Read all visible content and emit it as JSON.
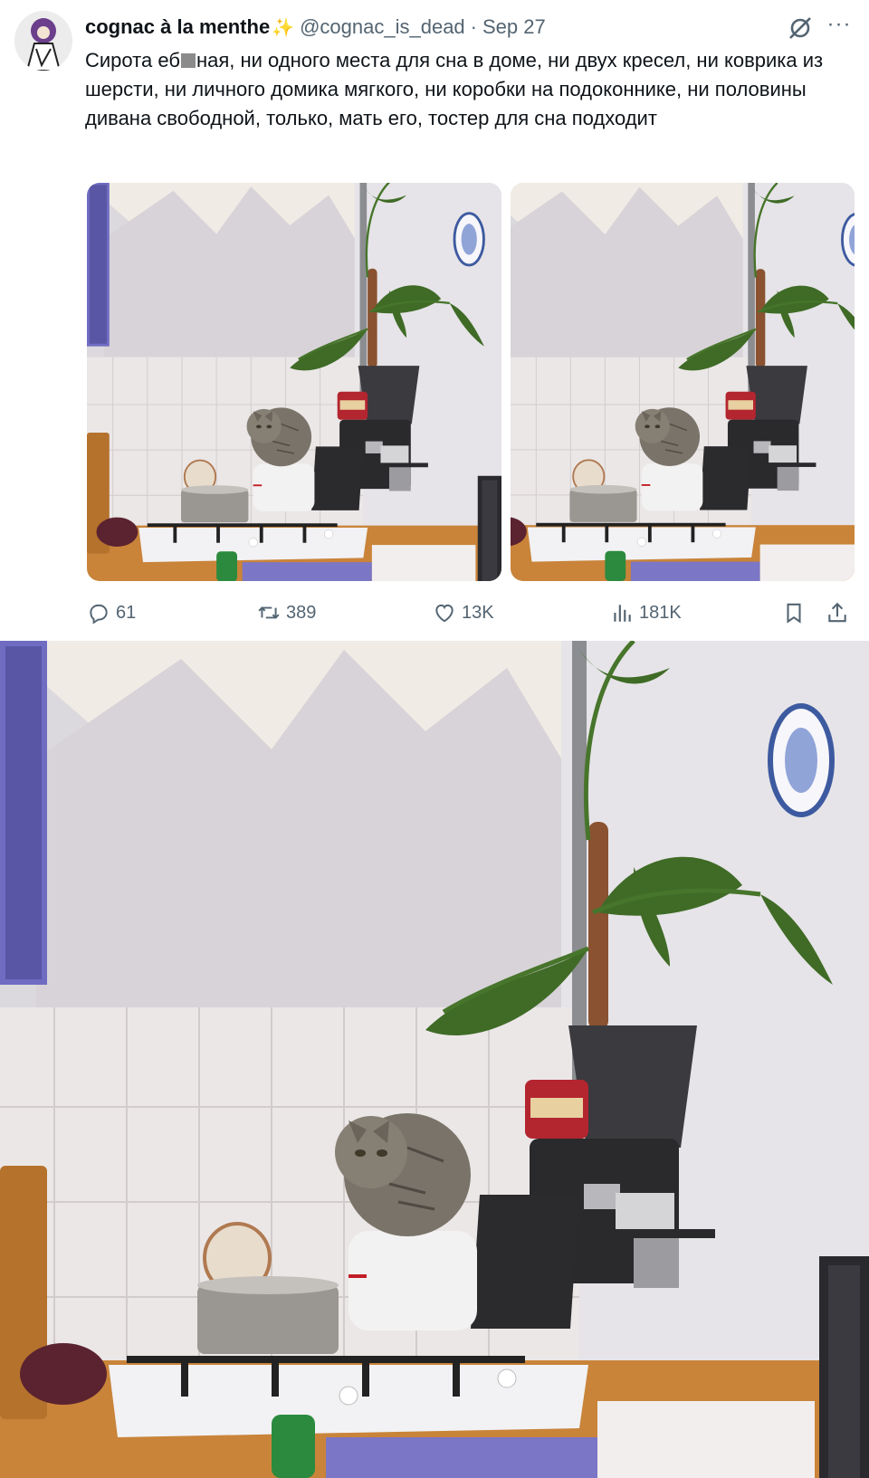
{
  "tweet": {
    "display_name": "cognac à la menthe",
    "sparkle": "✨",
    "handle": "@cognac_is_dead",
    "separator": "·",
    "date": "Sep 27",
    "text_before_redaction": "Сирота еб",
    "text_after_redaction": "ная, ни одного места для сна в доме, ни двух кресел, ни коврика из шерсти, ни личного домика мягкого, ни коробки на подоконнике, ни половины дивана свободной, только, мать его, тостер для сна подходит",
    "more": "···"
  },
  "icons": {
    "avatar": "avatar-image",
    "grok": "grok-icon",
    "more": "more-icon",
    "reply": "reply-icon",
    "retweet": "retweet-icon",
    "like": "heart-icon",
    "views": "views-icon",
    "bookmark": "bookmark-icon",
    "share": "share-icon"
  },
  "metrics": {
    "replies": "61",
    "retweets": "389",
    "likes": "13K",
    "views": "181K"
  },
  "colors": {
    "text": "#0f1419",
    "secondary": "#536471",
    "sparkle": "#f7c948",
    "wall": "#e4e2e6",
    "wall_peak": "#f1ede6",
    "counter": "#c9843a",
    "cabinet": "#7b76c6"
  }
}
